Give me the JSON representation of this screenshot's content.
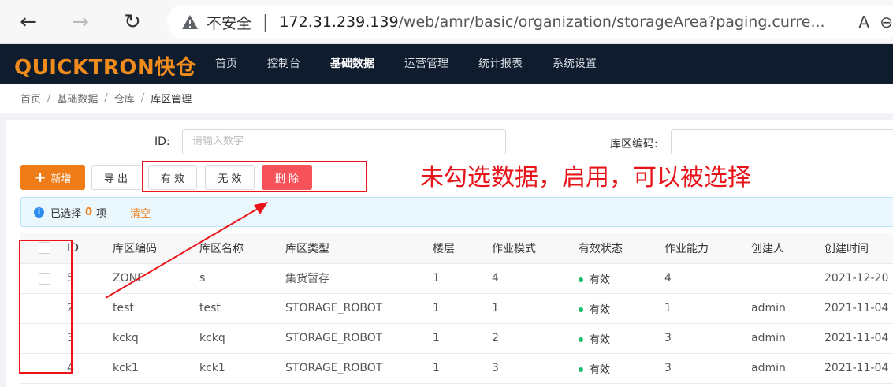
{
  "browser": {
    "insecure_label": "不安全",
    "url_host": "172.31.239.139",
    "url_path": "/web/amr/basic/organization/storageArea?paging.curre...",
    "read_aloud": "A",
    "more": "⊖"
  },
  "app": {
    "logo": "QUICKTRON快仓",
    "menu": [
      "首页",
      "控制台",
      "基础数据",
      "运营管理",
      "统计报表",
      "系统设置"
    ],
    "active_menu": "基础数据"
  },
  "breadcrumb": [
    "首页",
    "基础数据",
    "仓库",
    "库区管理"
  ],
  "filters": {
    "id_label": "ID:",
    "id_placeholder": "请输入数字",
    "code_label": "库区编码:"
  },
  "toolbar": {
    "new_label": "新增",
    "export_label": "导 出",
    "valid_label": "有 效",
    "invalid_label": "无 效",
    "delete_label": "删 除"
  },
  "selection": {
    "prefix": "已选择",
    "count": "0",
    "suffix": "项",
    "clear": "清空"
  },
  "table": {
    "columns": [
      "ID",
      "库区编码",
      "库区名称",
      "库区类型",
      "楼层",
      "作业模式",
      "有效状态",
      "作业能力",
      "创建人",
      "创建时间"
    ],
    "rows": [
      {
        "id": "5",
        "code": "ZONE",
        "name": "s",
        "type": "集货暂存",
        "floor": "1",
        "mode": "4",
        "status": "有效",
        "capacity": "4",
        "creator": "",
        "created": "2021-12-20"
      },
      {
        "id": "2",
        "code": "test",
        "name": "test",
        "type": "STORAGE_ROBOT",
        "floor": "1",
        "mode": "1",
        "status": "有效",
        "capacity": "1",
        "creator": "admin",
        "created": "2021-11-04"
      },
      {
        "id": "3",
        "code": "kckq",
        "name": "kckq",
        "type": "STORAGE_ROBOT",
        "floor": "1",
        "mode": "2",
        "status": "有效",
        "capacity": "3",
        "creator": "admin",
        "created": "2021-11-04"
      },
      {
        "id": "4",
        "code": "kck1",
        "name": "kck1",
        "type": "STORAGE_ROBOT",
        "floor": "1",
        "mode": "3",
        "status": "有效",
        "capacity": "3",
        "creator": "admin",
        "created": "2021-11-04"
      }
    ]
  },
  "annotation": {
    "text": "未勾选数据，启用，可以被选择",
    "color": "#e8141a"
  },
  "colors": {
    "brand": "#f07c17",
    "header_bg": "#0f1c2e",
    "danger": "#f5525a",
    "status_dot": "#19be6b"
  }
}
